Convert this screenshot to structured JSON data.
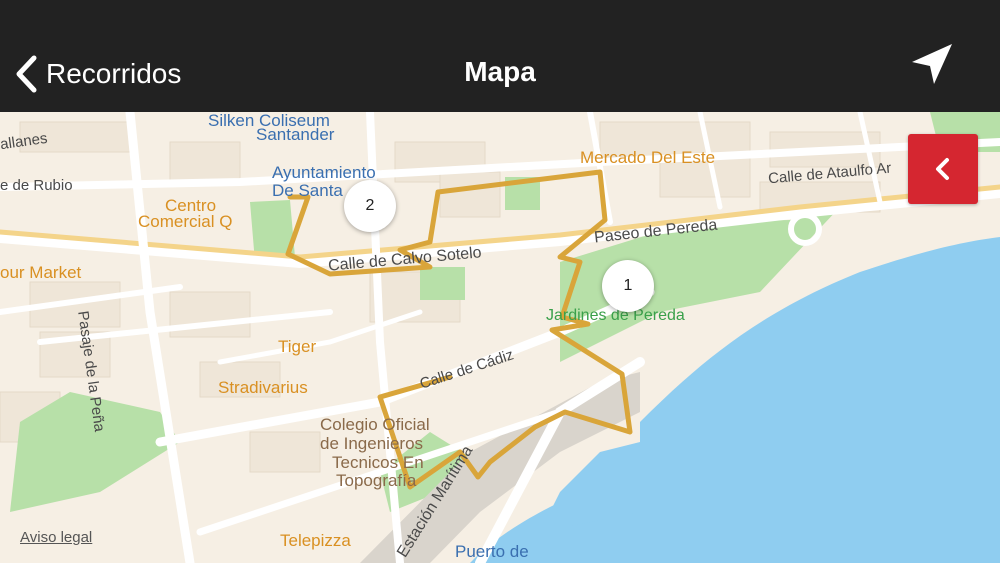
{
  "nav": {
    "back_label": "Recorridos",
    "title": "Mapa",
    "locate_icon": "location-arrow-icon"
  },
  "map": {
    "labels": {
      "salle_coliseum": "Silken Coliseum",
      "santander": "Santander",
      "ayuntamiento_1": "Ayuntamiento",
      "ayuntamiento_2": "De Santa",
      "mercado": "Mercado Del Este",
      "calle_ataulfo": "Calle de Ataulfo Ar",
      "ballanes": "allanes",
      "calle_rubio": "e de Rubio",
      "centro_1": "Centro",
      "centro_2": "Comercial Q",
      "paseo_pereda": "Paseo de Pereda",
      "calle_calvo": "Calle de Calvo Sotelo",
      "our_market": "our Market",
      "jardines": "Jardines de Pereda",
      "pasaje_pena": "Pasaje de la Peña",
      "tiger": "Tiger",
      "stradivarius": "Stradivarius",
      "calle_cadiz": "Calle de Cádiz",
      "colegio_1": "Colegio Oficial",
      "colegio_2": "de Ingenieros",
      "colegio_3": "Tecnicos En",
      "colegio_4": "Topografía",
      "estacion": "Estación Marítima",
      "telepizza": "Telepizza",
      "puerto": "Puerto de"
    },
    "markers": [
      "1",
      "2"
    ],
    "route_color": "#d9a53a",
    "water_color": "#8fcdf0",
    "park_color": "#a9dca0",
    "legal_link": "Aviso legal"
  },
  "panel": {
    "toggle_color": "#d52630"
  }
}
